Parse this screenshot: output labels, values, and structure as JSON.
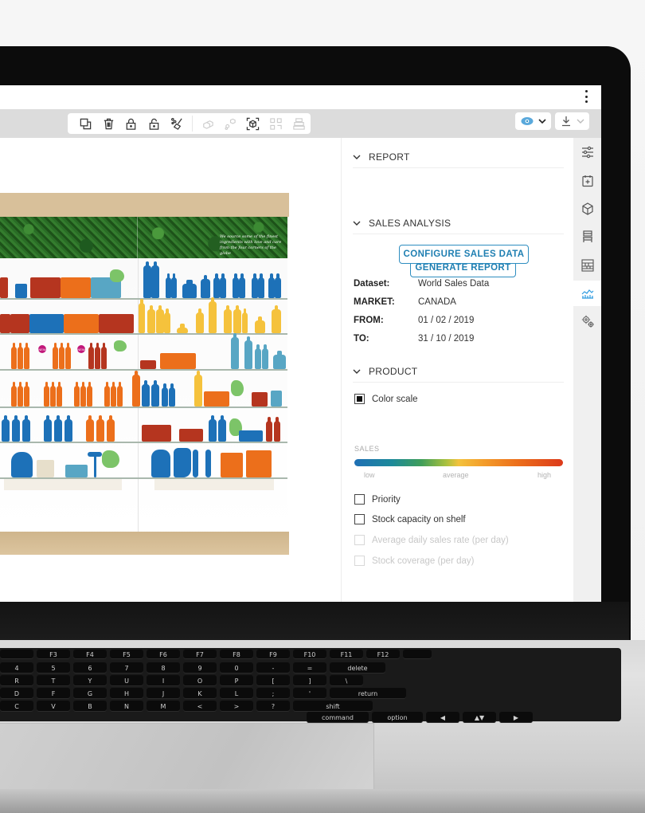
{
  "app": {
    "menu_icon": "kebab-vertical-icon"
  },
  "toolbar": {
    "tools": [
      {
        "name": "duplicate",
        "icon": "duplicate-icon",
        "enabled": true
      },
      {
        "name": "delete",
        "icon": "trash-icon",
        "enabled": true
      },
      {
        "name": "lock",
        "icon": "lock-icon",
        "enabled": true
      },
      {
        "name": "unlock",
        "icon": "unlock-icon",
        "enabled": true
      },
      {
        "name": "clean",
        "icon": "broom-icon",
        "enabled": true
      },
      {
        "name": "group",
        "icon": "cubes-group-icon",
        "enabled": false
      },
      {
        "name": "ungroup",
        "icon": "cubes-ungroup-icon",
        "enabled": false
      },
      {
        "name": "3d-view",
        "icon": "cube-focus-icon",
        "enabled": true
      },
      {
        "name": "swap",
        "icon": "swap-blocks-icon",
        "enabled": false
      },
      {
        "name": "shelf-stack",
        "icon": "shelf-stack-icon",
        "enabled": false
      }
    ],
    "view_button": {
      "icon": "eye-icon",
      "dropdown_icon": "chevron-down-icon",
      "accent": "#2e8dc0"
    },
    "download_button": {
      "icon": "download-icon",
      "dropdown_icon": "chevron-down-icon"
    }
  },
  "planogram": {
    "header_text": "We source some of the finest ingredients with love and care from the four corners of the globe",
    "badge_text": "NEW",
    "colors": {
      "wood": "#d8c09a",
      "blue": "#1d71b8",
      "light_blue": "#58a6c4",
      "orange": "#ec6f1b",
      "dark_red": "#b5351f",
      "yellow": "#f5c23c",
      "green_map": "#7cc468",
      "badge": "#c2187a"
    }
  },
  "panel": {
    "sections": {
      "report": {
        "title": "REPORT",
        "button": "GENERATE REPORT"
      },
      "sales_analysis": {
        "title": "SALES ANALYSIS",
        "button": "CONFIGURE SALES DATA",
        "fields": [
          {
            "label": "Dataset:",
            "value": "World Sales Data"
          },
          {
            "label": "MARKET:",
            "value": "CANADA"
          },
          {
            "label": "FROM:",
            "value": "01 / 02 / 2019"
          },
          {
            "label": "TO:",
            "value": "31 / 10 / 2019"
          }
        ]
      },
      "product": {
        "title": "PRODUCT",
        "color_scale": {
          "label": "Color scale",
          "checked": true
        },
        "scale": {
          "title": "SALES",
          "low": "low",
          "average": "average",
          "high": "high",
          "colors": [
            "#1f6fb5",
            "#3f9e5a",
            "#f3c23d",
            "#ec6f1b",
            "#dc3a1b"
          ]
        },
        "options": [
          {
            "label": "Priority",
            "checked": false,
            "enabled": true
          },
          {
            "label": "Stock capacity on shelf",
            "checked": false,
            "enabled": true
          },
          {
            "label": "Average daily sales rate (per day)",
            "checked": false,
            "enabled": false
          },
          {
            "label": "Stock coverage (per day)",
            "checked": false,
            "enabled": false
          }
        ]
      }
    }
  },
  "rail": {
    "items": [
      {
        "icon": "sliders-icon",
        "active": false
      },
      {
        "icon": "calendar-add-icon",
        "active": false
      },
      {
        "icon": "cube-icon",
        "active": false
      },
      {
        "icon": "chair-icon",
        "active": false
      },
      {
        "icon": "shelf-icon",
        "active": false
      },
      {
        "icon": "sales-chart-icon",
        "active": true
      },
      {
        "icon": "gears-icon",
        "active": false
      }
    ],
    "active_color": "#2e9be0"
  },
  "keyboard": {
    "rows": [
      [
        "",
        "F3",
        "F4",
        "F5",
        "F6",
        "F7",
        "F8",
        "F9",
        "F10",
        "F11",
        "F12",
        ""
      ],
      [
        "4",
        "5",
        "6",
        "7",
        "8",
        "9",
        "0",
        "-",
        "=",
        "delete"
      ],
      [
        "R",
        "T",
        "Y",
        "U",
        "I",
        "O",
        "P",
        "[",
        "]",
        "\\"
      ],
      [
        "D",
        "F",
        "G",
        "H",
        "J",
        "K",
        "L",
        ";",
        "'",
        "return"
      ],
      [
        "C",
        "V",
        "B",
        "N",
        "M",
        "<",
        ">",
        "?",
        "shift"
      ],
      [
        "command",
        "option",
        "◀",
        "▲▼",
        "▶"
      ]
    ]
  }
}
